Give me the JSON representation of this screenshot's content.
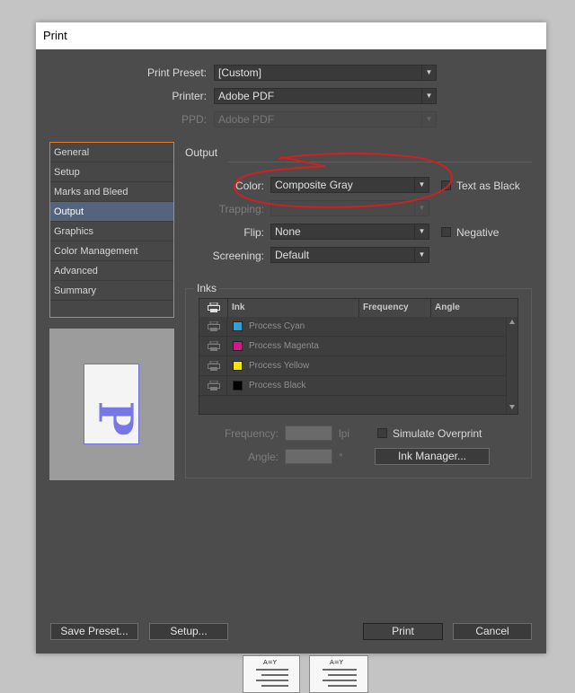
{
  "window": {
    "title": "Print"
  },
  "top": {
    "print_preset": {
      "label": "Print Preset:",
      "value": "[Custom]"
    },
    "printer": {
      "label": "Printer:",
      "value": "Adobe PDF"
    },
    "ppd": {
      "label": "PPD:",
      "value": "Adobe PDF"
    }
  },
  "nav": {
    "items": [
      {
        "label": "General"
      },
      {
        "label": "Setup"
      },
      {
        "label": "Marks and Bleed"
      },
      {
        "label": "Output"
      },
      {
        "label": "Graphics"
      },
      {
        "label": "Color Management"
      },
      {
        "label": "Advanced"
      },
      {
        "label": "Summary"
      }
    ],
    "active": "Output"
  },
  "preview": {
    "glyph": "P"
  },
  "output": {
    "title": "Output",
    "color": {
      "label": "Color:",
      "value": "Composite Gray"
    },
    "text_as_black": "Text as Black",
    "trapping": {
      "label": "Trapping:",
      "value": ""
    },
    "flip": {
      "label": "Flip:",
      "value": "None"
    },
    "negative": "Negative",
    "screening": {
      "label": "Screening:",
      "value": "Default"
    }
  },
  "inks": {
    "title": "Inks",
    "columns": [
      "Ink",
      "Frequency",
      "Angle"
    ],
    "rows": [
      {
        "name": "Process Cyan",
        "color": "#29a3d8"
      },
      {
        "name": "Process Magenta",
        "color": "#d0178c"
      },
      {
        "name": "Process Yellow",
        "color": "#f5e400"
      },
      {
        "name": "Process Black",
        "color": "#000000"
      }
    ],
    "frequency_label": "Frequency:",
    "frequency_unit": "lpi",
    "angle_label": "Angle:",
    "angle_unit": "°",
    "simulate_overprint": "Simulate Overprint",
    "ink_manager": "Ink Manager..."
  },
  "buttons": {
    "save_preset": "Save Preset...",
    "setup": "Setup...",
    "print": "Print",
    "cancel": "Cancel"
  },
  "thumbnails": {
    "label": "A=Y"
  },
  "annotation_color": "#d21f1f"
}
